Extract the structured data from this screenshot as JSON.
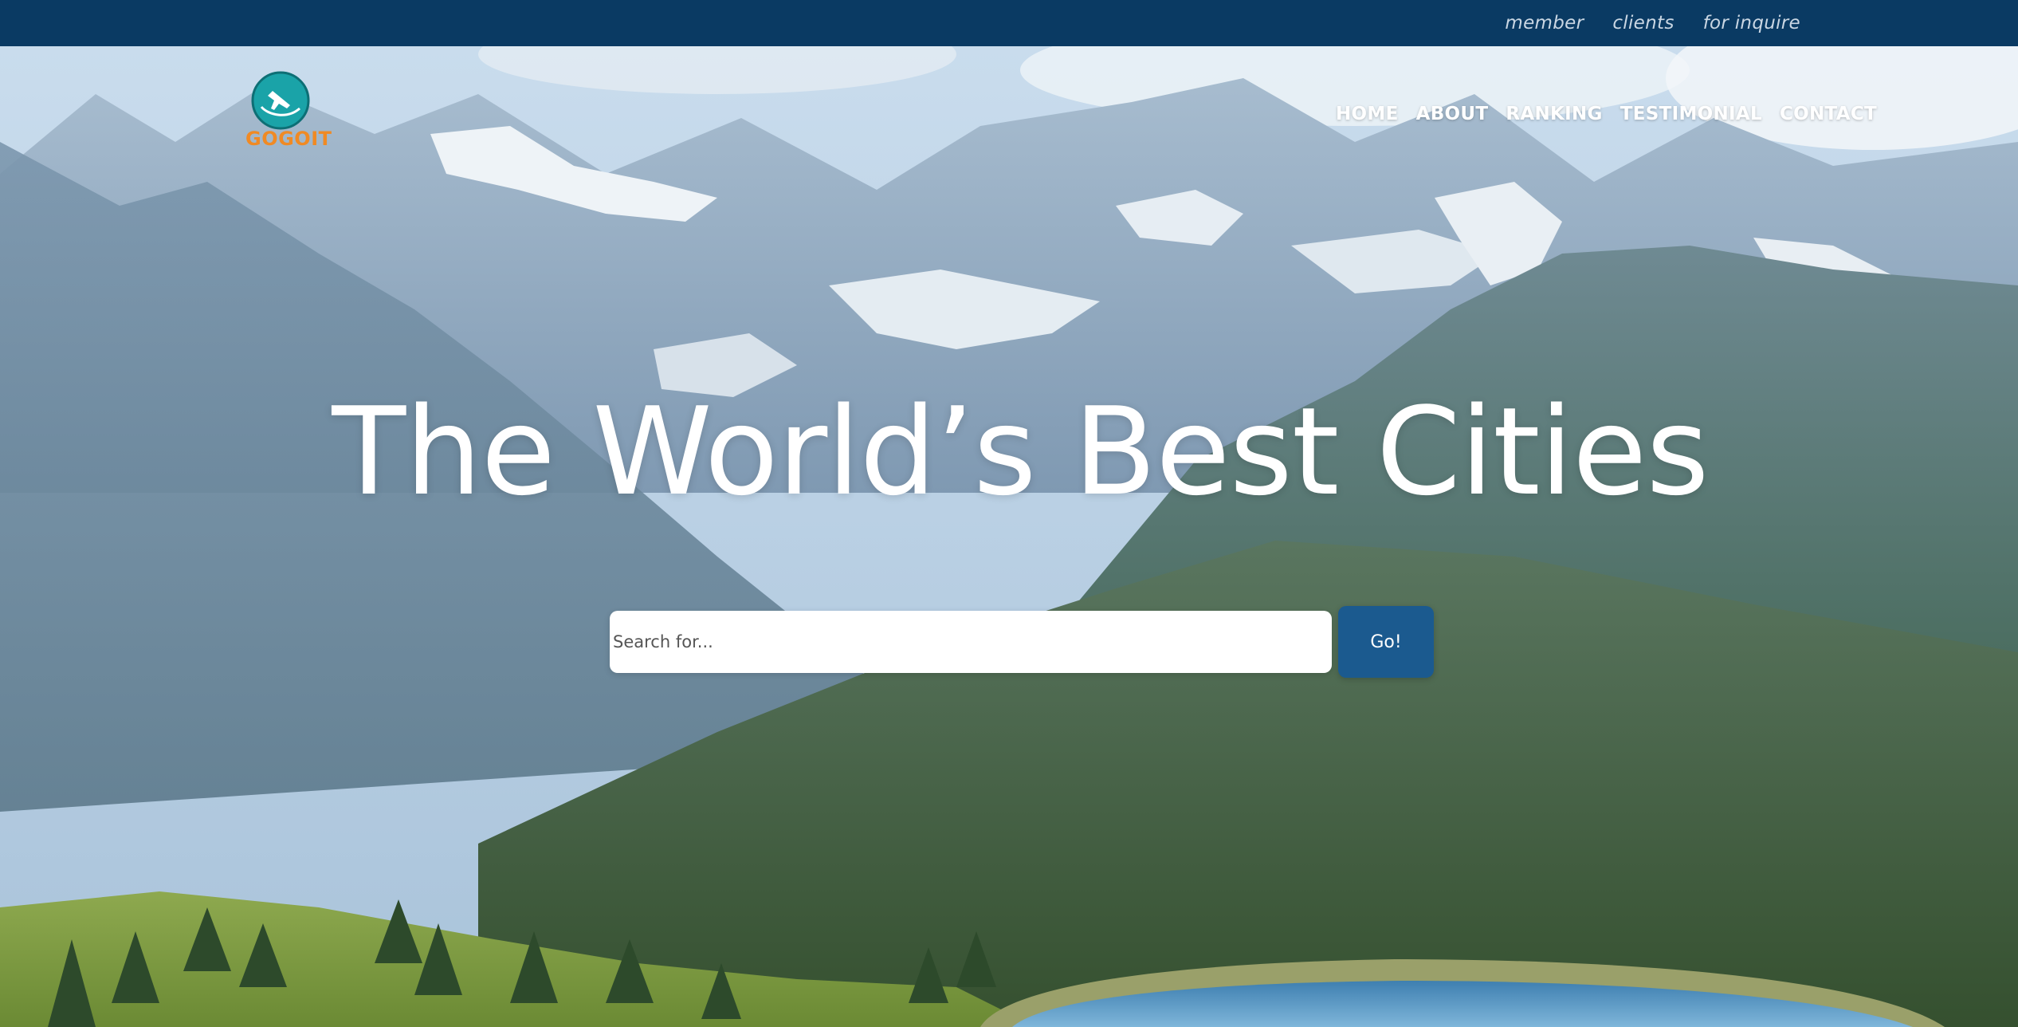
{
  "topbar": {
    "links": [
      "member",
      "clients",
      "for inquire"
    ],
    "background": "#0a3a63"
  },
  "logo": {
    "text": "GOGOIT",
    "icon": "airplane-icon",
    "text_color": "#f08a24",
    "mark_color": "#1aa3a8"
  },
  "nav": {
    "items": [
      "HOME",
      "ABOUT",
      "RANKING",
      "TESTIMONIAL",
      "CONTACT"
    ]
  },
  "hero": {
    "headline": "The World’s Best Cities",
    "background": "mountain-landscape-with-lake"
  },
  "search": {
    "placeholder": "Search for...",
    "button_label": "Go!",
    "button_color": "#1b5a8f"
  }
}
